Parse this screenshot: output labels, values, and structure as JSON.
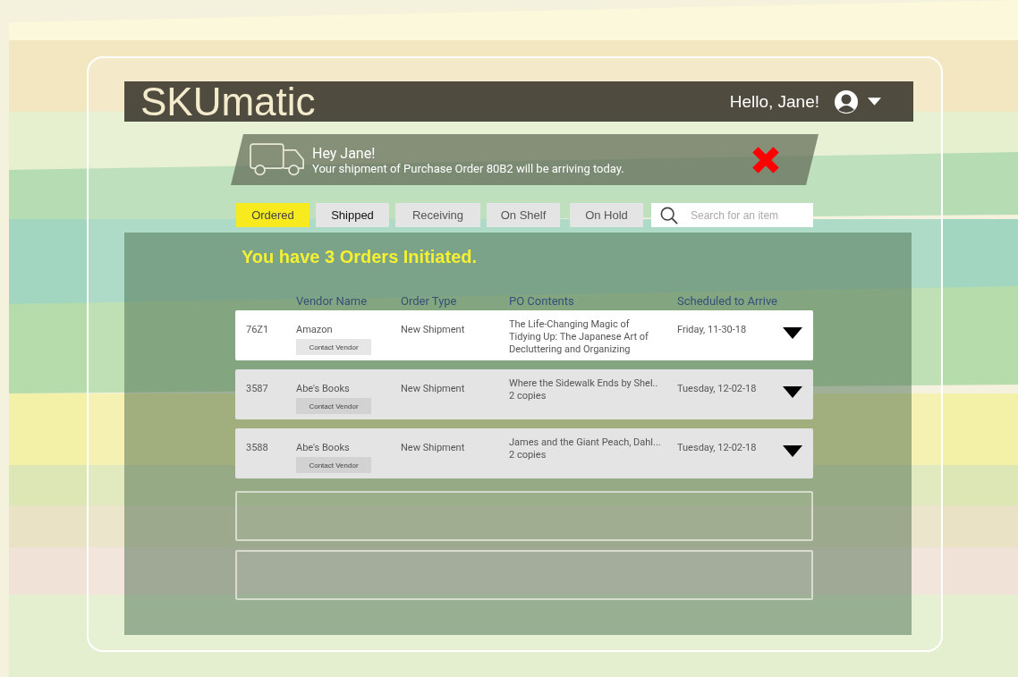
{
  "header": {
    "brand": "SKUmatic",
    "greeting": "Hello, Jane!"
  },
  "notification": {
    "title": "Hey Jane!",
    "message": "Your shipment of Purchase Order 80B2 will be arriving today."
  },
  "tabs": [
    {
      "label": "Ordered",
      "selected": true
    },
    {
      "label": "Shipped",
      "selected": false
    },
    {
      "label": "Receiving",
      "selected": false
    },
    {
      "label": "On Shelf",
      "selected": false
    },
    {
      "label": "On Hold",
      "selected": false
    }
  ],
  "search": {
    "placeholder": "Search for an item"
  },
  "orders": {
    "heading": "You have 3 Orders Initiated.",
    "columns": [
      "Vendor Name",
      "Order Type",
      "PO Contents",
      "Scheduled to Arrive"
    ],
    "rows": [
      {
        "kind": "order",
        "selected": true,
        "id": "76Z1",
        "vendor": "Amazon",
        "contact": "Contact Vendor",
        "type": "New Shipment",
        "contents": "The Life-Changing Magic of Tidying Up: The Japanese Art of Decluttering and Organizing",
        "date": "Friday, 11-30-18"
      },
      {
        "kind": "order",
        "selected": false,
        "id": "3587",
        "vendor": "Abe's Books",
        "contact": "Contact Vendor",
        "type": "New Shipment",
        "contents": "Where the Sidewalk Ends by Shel..",
        "quantity": "2 copies",
        "date": "Tuesday, 12-02-18"
      },
      {
        "kind": "order",
        "selected": false,
        "id": "3588",
        "vendor": "Abe's Books",
        "contact": "Contact Vendor",
        "type": "New Shipment",
        "contents": "James and the Giant Peach, Dahl...",
        "quantity": "2 copies",
        "date": "Tuesday, 12-02-18"
      },
      {
        "kind": "empty"
      },
      {
        "kind": "empty"
      }
    ]
  }
}
